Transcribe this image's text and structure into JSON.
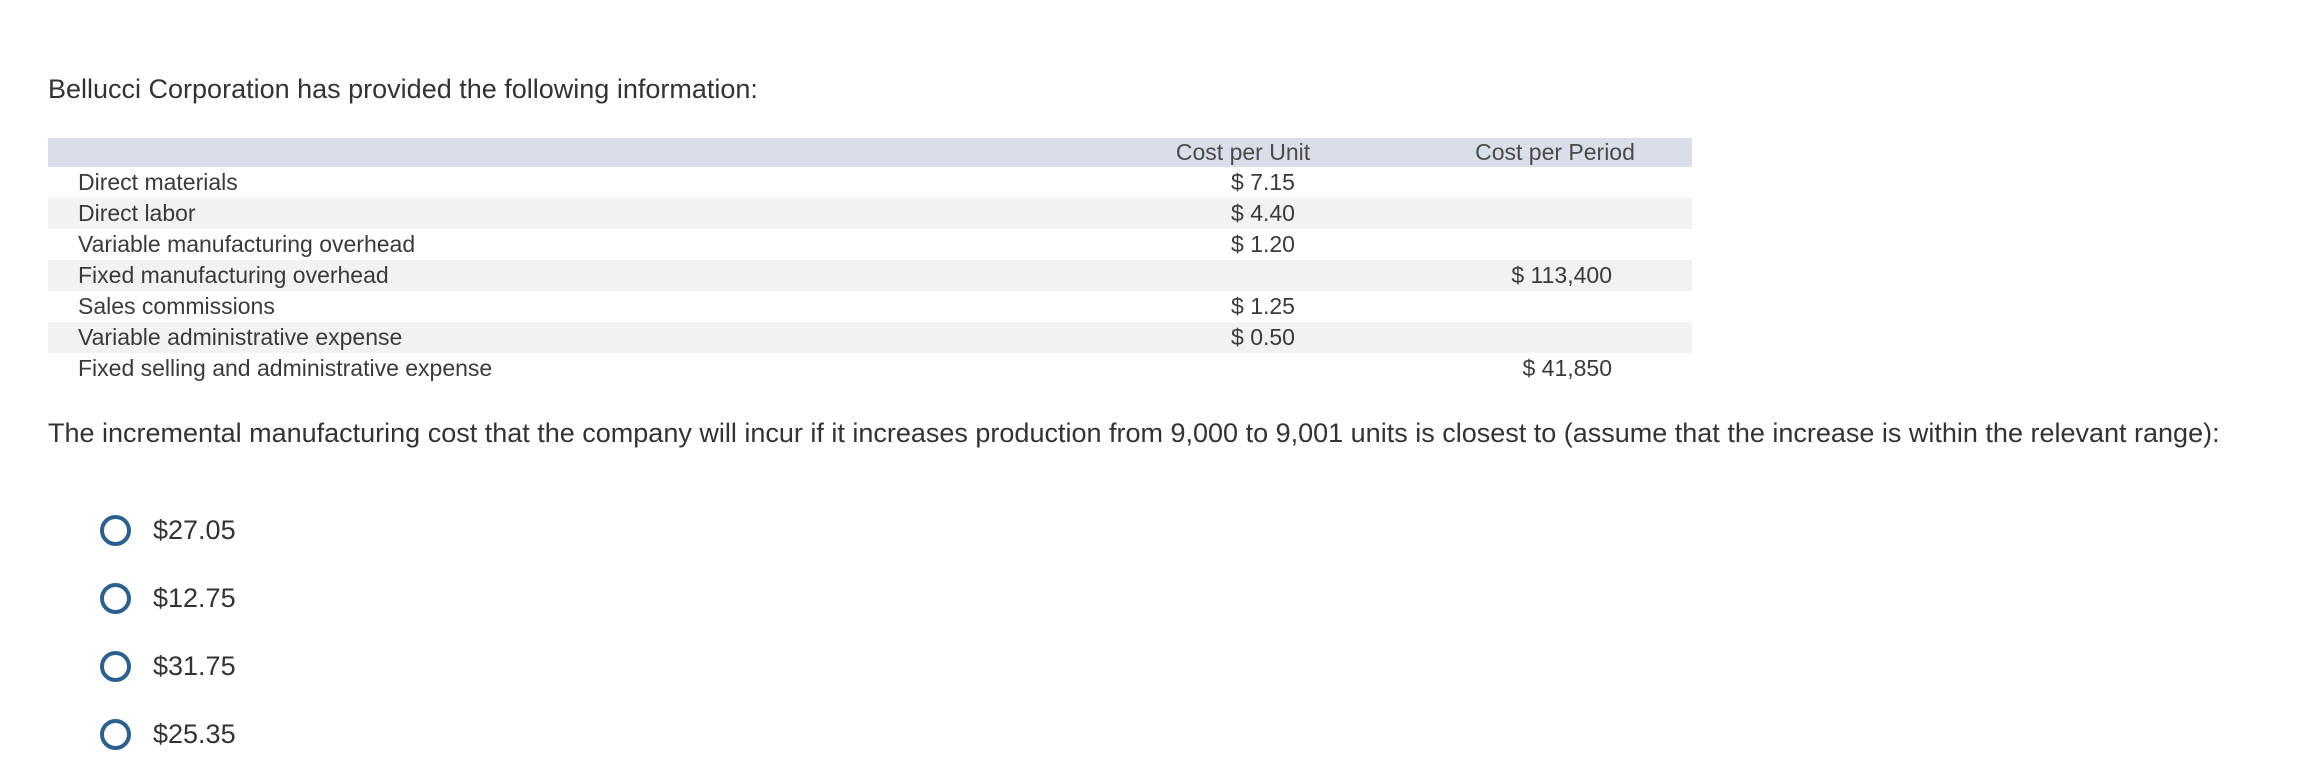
{
  "intro_text": "Bellucci Corporation has provided the following information:",
  "table": {
    "headers": {
      "label": "",
      "unit": "Cost per Unit",
      "period": "Cost per Period"
    },
    "rows": [
      {
        "label": "Direct materials",
        "unit": "$ 7.15",
        "period": ""
      },
      {
        "label": "Direct labor",
        "unit": "$ 4.40",
        "period": ""
      },
      {
        "label": "Variable manufacturing overhead",
        "unit": "$ 1.20",
        "period": ""
      },
      {
        "label": "Fixed manufacturing overhead",
        "unit": "",
        "period": "$ 113,400"
      },
      {
        "label": "Sales commissions",
        "unit": "$ 1.25",
        "period": ""
      },
      {
        "label": "Variable administrative expense",
        "unit": "$ 0.50",
        "period": ""
      },
      {
        "label": "Fixed selling and administrative expense",
        "unit": "",
        "period": "$ 41,850"
      }
    ]
  },
  "question_text": "The incremental manufacturing cost that the company will incur if it increases production from 9,000 to 9,001 units is closest to (assume that the increase is within the relevant range):",
  "options": [
    {
      "label": "$27.05"
    },
    {
      "label": "$12.75"
    },
    {
      "label": "$31.75"
    },
    {
      "label": "$25.35"
    }
  ],
  "colors": {
    "header_bg": "#d9dee8",
    "stripe_bg": "#f2f2f2",
    "radio_border": "#2c5f8d",
    "text": "#333333"
  }
}
